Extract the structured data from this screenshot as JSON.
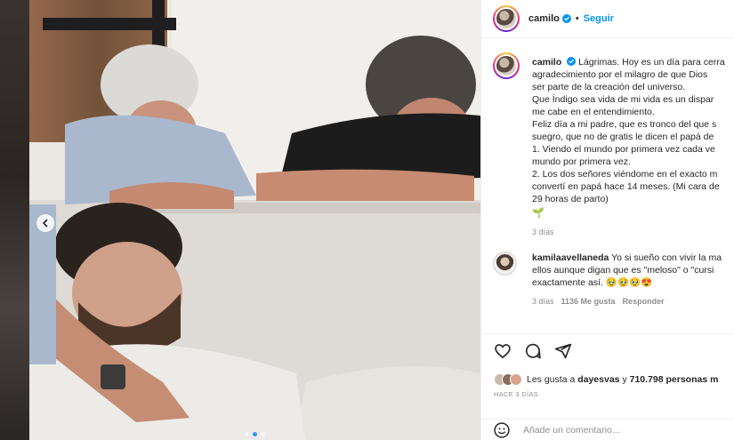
{
  "post": {
    "username": "camilo",
    "follow_label": "Seguir",
    "separator": "•"
  },
  "caption": {
    "username": "camilo",
    "lines": [
      "Lágrimas. Hoy es un día para cerra",
      "agradecimiento por el milagro de que Dios",
      "ser parte de la creación del universo.",
      "Que Índigo sea vida de mi vida es un dispar",
      "me cabe en el entendimiento.",
      "Feliz día a mi padre, que es tronco del que s",
      "suegro, que no de gratis le dicen el papá de",
      "1. Viendo el mundo por primera vez cada ve",
      "mundo por primera vez.",
      "2. Los dos señores viéndome en el exacto m",
      "convertí en papá hace 14 meses. (Mi cara de",
      "29 horas de parto)"
    ],
    "sprout": "🌱",
    "time": "3 días"
  },
  "reply": {
    "username": "kamilaavellaneda",
    "lines": [
      "Yo si sueño con vivir la ma",
      "ellos aunque digan que es \"meloso\" o \"cursi",
      "exactamente así. 🥹🥹🥹😍"
    ],
    "time": "3 días",
    "likes": "1136 Me gusta",
    "reply_label": "Responder"
  },
  "actions": {
    "likes_prefix": "Les gusta a",
    "likes_user": "dayesvas",
    "likes_and": "y",
    "likes_count": "710.798 personas m",
    "date": "HACE 3 DÍAS",
    "comment_placeholder": "Añade un comentario..."
  },
  "carousel": {
    "dots": 3,
    "active_index": 1
  },
  "colors": {
    "accent": "#0095f6",
    "verified": "#0095f6",
    "muted": "#8e8e8e",
    "text": "#262626"
  }
}
